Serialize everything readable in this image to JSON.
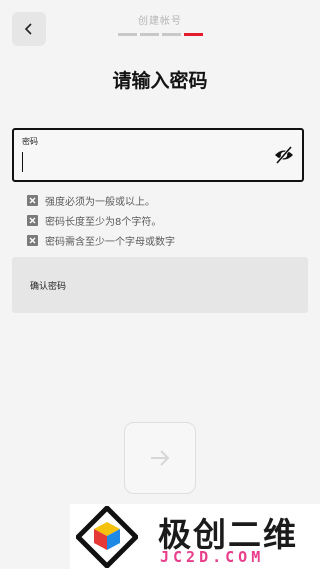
{
  "header": {
    "title": "创建帐号",
    "steps_total": 4,
    "active_step": 4
  },
  "page": {
    "title": "请输入密码"
  },
  "password_field": {
    "label": "密码",
    "value": ""
  },
  "rules": [
    "强度必须为一般或以上。",
    "密码长度至少为8个字符。",
    "密码需含至少一个字母或数字"
  ],
  "confirm_field": {
    "label": "确认密码"
  },
  "watermark": {
    "cn": "极创二维",
    "en": "JC2D.COM"
  },
  "icons": {
    "back": "chevron-left-icon",
    "visibility": "eye-slash-icon",
    "rule_status": "x-square-icon",
    "next": "arrow-right-icon"
  },
  "colors": {
    "accent": "#e31b2b",
    "watermark_pink": "#e83e8c"
  }
}
